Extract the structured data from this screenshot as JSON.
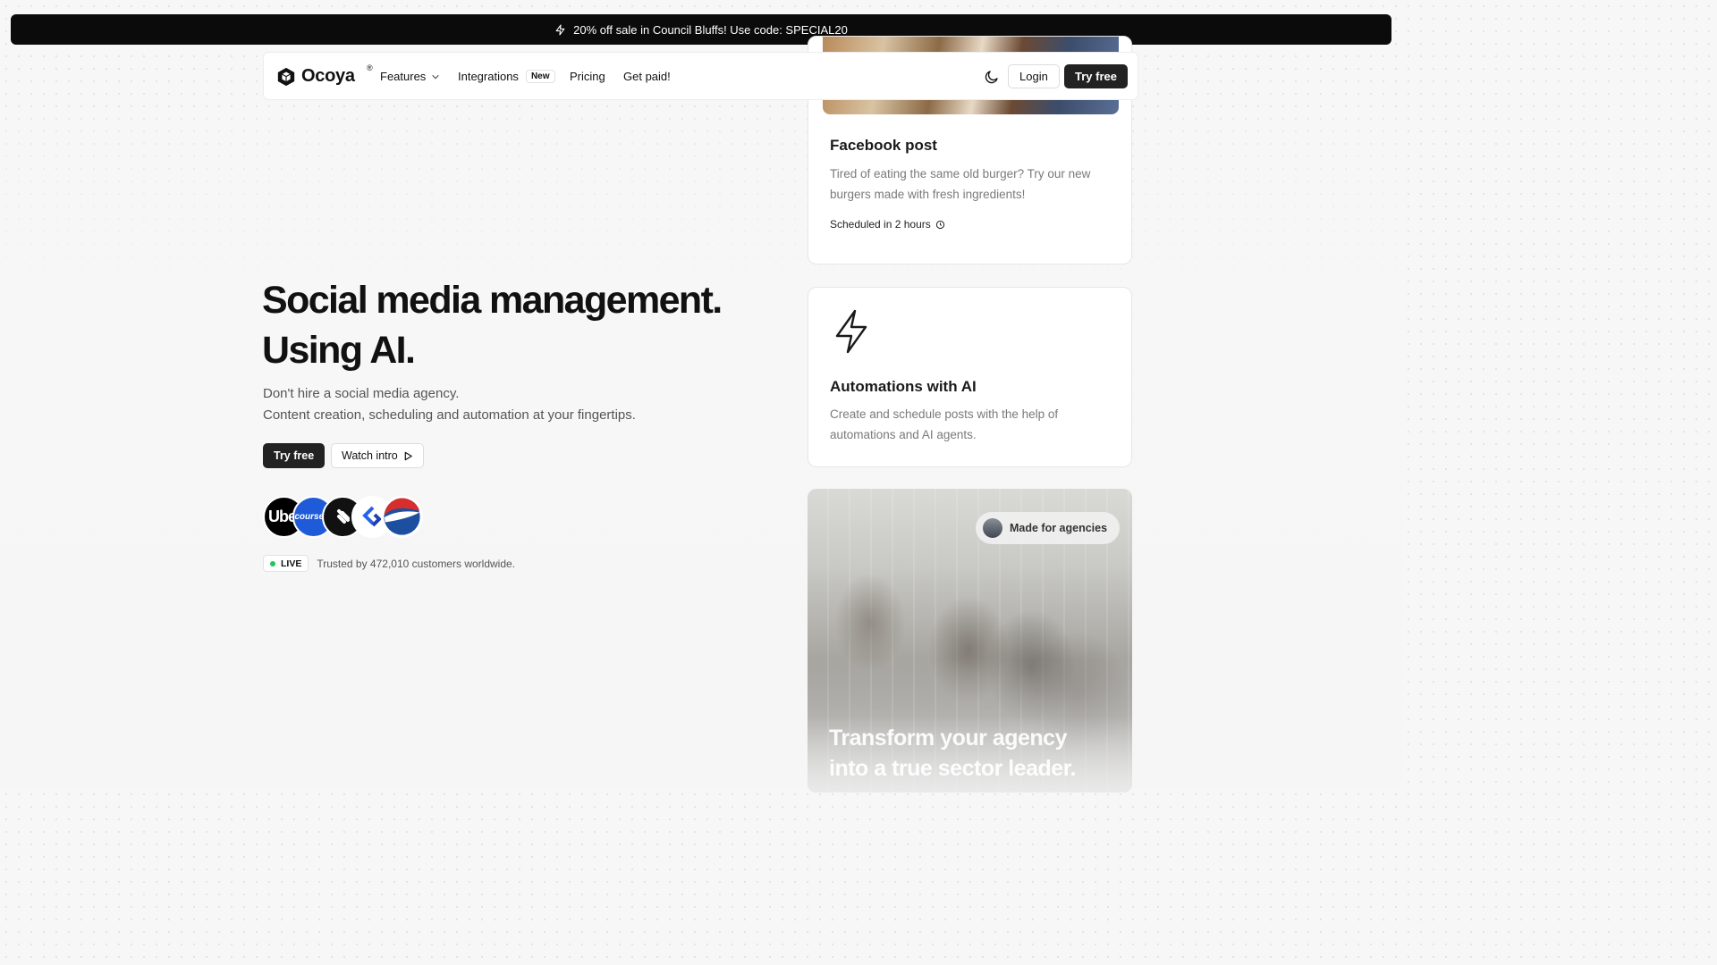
{
  "promo": {
    "text": "20% off sale in Council Bluffs! Use code: SPECIAL20",
    "icon": "lightning-icon"
  },
  "nav": {
    "logo_text": "Ocoya",
    "logo_mark": "®",
    "items": [
      {
        "label": "Features",
        "icon": "chevron-down-icon"
      },
      {
        "label": "Integrations",
        "badge": "New"
      },
      {
        "label": "Pricing"
      },
      {
        "label": "Get paid!"
      }
    ],
    "theme_icon": "moon-icon",
    "login_label": "Login",
    "try_label": "Try free"
  },
  "hero": {
    "title_line1": "Social media management.",
    "title_line2": "Using AI.",
    "sub_line1": "Don't hire a social media agency.",
    "sub_line2": "Content creation, scheduling and automation at your fingertips.",
    "try_label": "Try free",
    "watch_label": "Watch intro",
    "customer_logos": [
      "Uber",
      "coursera",
      "Squarespace",
      "Jira",
      "Pepsi"
    ],
    "logo_text_uber": "Uber",
    "logo_text_coursera": "coursera",
    "live_label": "LIVE",
    "trusted_text": "Trusted by 472,010 customers worldwide."
  },
  "cards": {
    "facebook": {
      "title": "Facebook post",
      "desc": "Tired of eating the same old burger? Try our new burgers made with fresh ingredients!",
      "scheduled": "Scheduled in 2 hours",
      "icon": "clock-icon"
    },
    "automations": {
      "title": "Automations with AI",
      "desc": "Create and schedule posts with the help of automations and AI agents.",
      "icon": "lightning-icon"
    },
    "agency": {
      "badge": "Made for agencies",
      "headline": "Transform your agency into a true sector leader."
    }
  },
  "colors": {
    "primary_button": "#222222",
    "live_dot": "#22c55e",
    "banner": "#0b0b0b"
  }
}
